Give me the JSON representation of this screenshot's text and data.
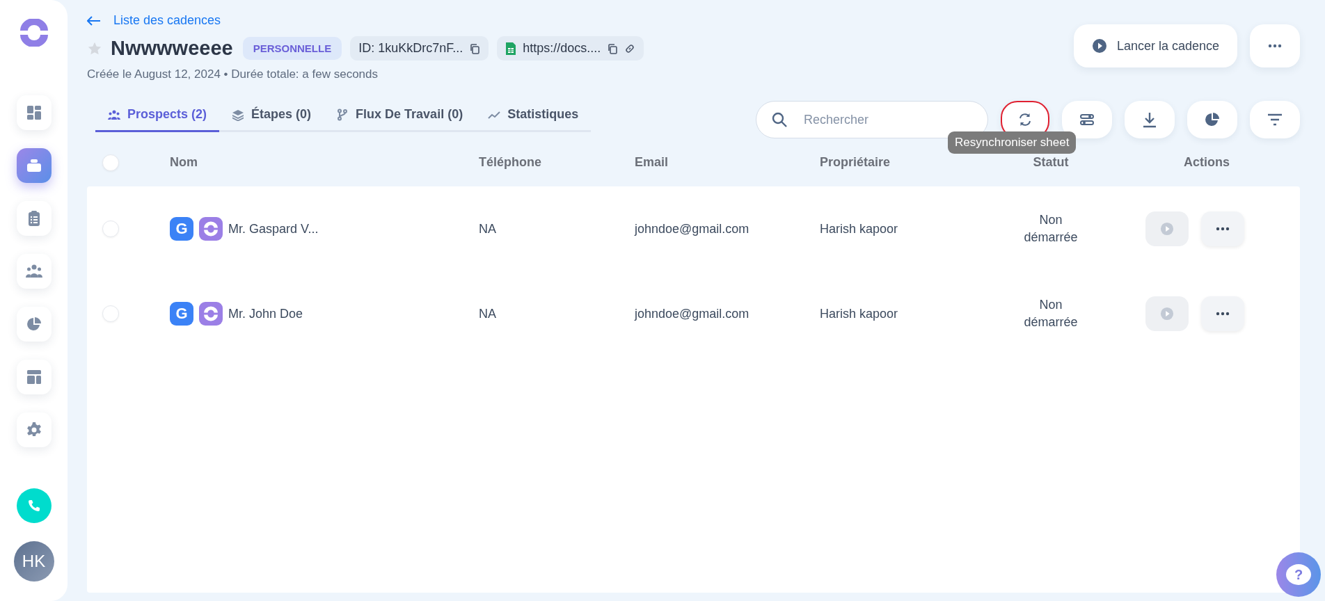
{
  "sidebar": {
    "items": [
      {
        "kind": "dashboard",
        "selected": false
      },
      {
        "kind": "cadences",
        "selected": true
      },
      {
        "kind": "clipboard",
        "selected": false
      },
      {
        "kind": "team",
        "selected": false
      },
      {
        "kind": "pie",
        "selected": false
      },
      {
        "kind": "layout",
        "selected": false
      },
      {
        "kind": "settings",
        "selected": false
      }
    ],
    "avatar": "HK"
  },
  "header": {
    "back_link": "Liste des cadences",
    "starred": false,
    "title": "Nwwwweeee",
    "badge": "PERSONNELLE",
    "id_chip": "ID: 1kuKkDrc7nF...",
    "sheet_chip": "https://docs....",
    "subtitle": "Créée le August 12, 2024 • Durée totale: a few seconds",
    "launch_button": "Lancer la cadence"
  },
  "tabs": [
    {
      "label": "Prospects (2)",
      "kind": "people",
      "selected": true
    },
    {
      "label": "Étapes (0)",
      "kind": "layers",
      "selected": false
    },
    {
      "label": "Flux De Travail (0)",
      "kind": "branch",
      "selected": false
    },
    {
      "label": "Statistiques",
      "kind": "trend",
      "selected": false
    }
  ],
  "search": {
    "placeholder": "Rechercher"
  },
  "toolbar": [
    {
      "kind": "refresh",
      "highlighted": true
    },
    {
      "kind": "sliders",
      "highlighted": false
    },
    {
      "kind": "download",
      "highlighted": false
    },
    {
      "kind": "pie",
      "highlighted": false
    },
    {
      "kind": "filter",
      "highlighted": false
    }
  ],
  "tooltip": "Resynchroniser sheet",
  "table": {
    "all_checked": false,
    "columns": [
      "Nom",
      "Téléphone",
      "Email",
      "Propriétaire",
      "Statut",
      "Actions"
    ],
    "rows": [
      {
        "checked": false,
        "badge": "G",
        "name": "Mr. Gaspard V...",
        "phone": "NA",
        "email": "johndoe@gmail.com",
        "owner": "Harish kapoor",
        "status": "Non démarrée"
      },
      {
        "checked": false,
        "badge": "G",
        "name": "Mr. John Doe",
        "phone": "NA",
        "email": "johndoe@gmail.com",
        "owner": "Harish kapoor",
        "status": "Non démarrée"
      }
    ]
  },
  "help": {
    "label": "?"
  }
}
